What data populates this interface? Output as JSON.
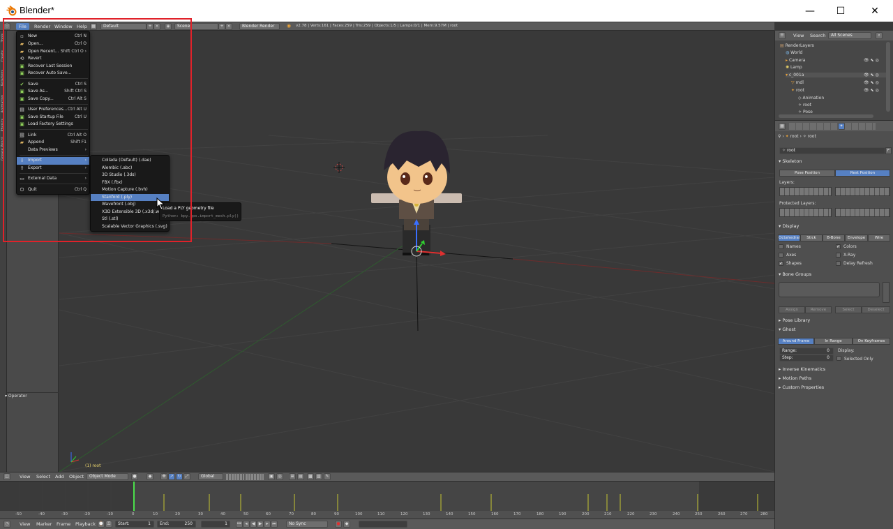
{
  "window": {
    "title": "Blender*",
    "minimize": "—",
    "maximize": "☐",
    "close": "✕"
  },
  "topbar": {
    "menus": [
      "File",
      "Render",
      "Window",
      "Help"
    ],
    "layout": "Default",
    "scene": "Scene",
    "engine": "Blender Render",
    "stats": "v2.78 | Verts:161 | Faces:259 | Tris:259 | Objects:1/5 | Lamps:0/1 | Mem:9.57M | root"
  },
  "file_menu": {
    "items": [
      {
        "label": "New",
        "shortcut": "Ctrl N",
        "icon": "new-file-icon"
      },
      {
        "label": "Open...",
        "shortcut": "Ctrl O",
        "icon": "open-folder-icon"
      },
      {
        "label": "Open Recent...",
        "shortcut": "Shift Ctrl O ›",
        "icon": "open-recent-icon"
      },
      {
        "label": "Revert",
        "shortcut": "",
        "icon": "revert-icon"
      },
      {
        "label": "Recover Last Session",
        "shortcut": "",
        "icon": "recover-icon"
      },
      {
        "label": "Recover Auto Save...",
        "shortcut": "",
        "icon": "recover-auto-icon"
      },
      {
        "label": "Save",
        "shortcut": "Ctrl S",
        "icon": "save-icon"
      },
      {
        "label": "Save As...",
        "shortcut": "Shift Ctrl S",
        "icon": "save-as-icon"
      },
      {
        "label": "Save Copy...",
        "shortcut": "Ctrl Alt S",
        "icon": "save-copy-icon"
      },
      {
        "label": "User Preferences...",
        "shortcut": "Ctrl Alt U",
        "icon": "preferences-icon"
      },
      {
        "label": "Save Startup File",
        "shortcut": "Ctrl U",
        "icon": "save-startup-icon"
      },
      {
        "label": "Load Factory Settings",
        "shortcut": "",
        "icon": "factory-icon"
      },
      {
        "label": "Link",
        "shortcut": "Ctrl Alt O",
        "icon": "link-icon"
      },
      {
        "label": "Append",
        "shortcut": "Shift F1",
        "icon": "append-icon"
      },
      {
        "label": "Data Previews",
        "shortcut": "›",
        "icon": ""
      },
      {
        "label": "Import",
        "shortcut": "›",
        "icon": "import-icon"
      },
      {
        "label": "Export",
        "shortcut": "›",
        "icon": "export-icon"
      },
      {
        "label": "External Data",
        "shortcut": "›",
        "icon": "external-data-icon"
      },
      {
        "label": "Quit",
        "shortcut": "Ctrl Q",
        "icon": "quit-icon"
      }
    ]
  },
  "import_menu": {
    "items": [
      "Collada (Default) (.dae)",
      "Alembic (.abc)",
      "3D Studio (.3ds)",
      "FBX (.fbx)",
      "Motion Capture (.bvh)",
      "Stanford (.ply)",
      "Wavefront (.obj)",
      "X3D Extensible 3D (.x3d/.wrl)",
      "Stl (.stl)",
      "Scalable Vector Graphics (.svg)"
    ]
  },
  "tooltip": {
    "title": "Load a PLY geometry file",
    "python": "Python: bpy.ops.import_mesh.ply()"
  },
  "toolshelf": {
    "tabs": [
      "Tools",
      "Create",
      "Relations",
      "Animation",
      "Physics",
      "Grease Pencil"
    ],
    "operator": "▾ Operator"
  },
  "viewport": {
    "object_label": "(1) root"
  },
  "viewport_header": {
    "view": "View",
    "select": "Select",
    "add": "Add",
    "object": "Object",
    "mode": "Object Mode",
    "orientation": "Global"
  },
  "timeline": {
    "ticks": [
      "-50",
      "-40",
      "-30",
      "-20",
      "-10",
      "0",
      "10",
      "20",
      "30",
      "40",
      "50",
      "60",
      "70",
      "80",
      "90",
      "100",
      "110",
      "120",
      "130",
      "140",
      "150",
      "160",
      "170",
      "180",
      "190",
      "200",
      "210",
      "220",
      "230",
      "240",
      "250",
      "260",
      "270",
      "280"
    ],
    "view": "View",
    "marker": "Marker",
    "frame": "Frame",
    "playback": "Playback",
    "start": "Start:",
    "start_val": "1",
    "end": "End:",
    "end_val": "250",
    "current": "1",
    "sync": "No Sync"
  },
  "outliner": {
    "view": "View",
    "search": "Search",
    "filter": "All Scenes",
    "rows": [
      "RenderLayers",
      "World",
      "Camera",
      "Lamp",
      "c_001a",
      "mdl",
      "root",
      "Animation",
      "root",
      "Pose"
    ]
  },
  "properties": {
    "breadcrumb": "root",
    "breadcrumb2": "root",
    "name_field": "root",
    "name_flag": "F",
    "skeleton": "Skeleton",
    "pose_position": "Pose Position",
    "rest_position": "Rest Position",
    "layers": "Layers:",
    "protected_layers": "Protected Layers:",
    "display": "Display",
    "display_modes": [
      "Octahedral",
      "Stick",
      "B-Bone",
      "Envelope",
      "Wire"
    ],
    "names": "Names",
    "colors": "Colors",
    "axes": "Axes",
    "xray": "X-Ray",
    "shapes": "Shapes",
    "delay_refresh": "Delay Refresh",
    "bone_groups": "Bone Groups",
    "group_buttons": [
      "Assign",
      "Remove",
      "Select",
      "Deselect"
    ],
    "pose_library": "Pose Library",
    "ghost": "Ghost",
    "ghost_modes": [
      "Around Frame",
      "In Range",
      "On Keyframes"
    ],
    "range": "Range:",
    "range_val": "0",
    "step": "Step:",
    "step_val": "0",
    "display_label": "Display:",
    "selected_only": "Selected Only",
    "inverse_kinematics": "Inverse Kinematics",
    "motion_paths": "Motion Paths",
    "custom_properties": "Custom Properties"
  },
  "colors": {
    "highlight": "#5680c2",
    "menu_bg": "#191919",
    "red_annotation": "#e0222a"
  }
}
